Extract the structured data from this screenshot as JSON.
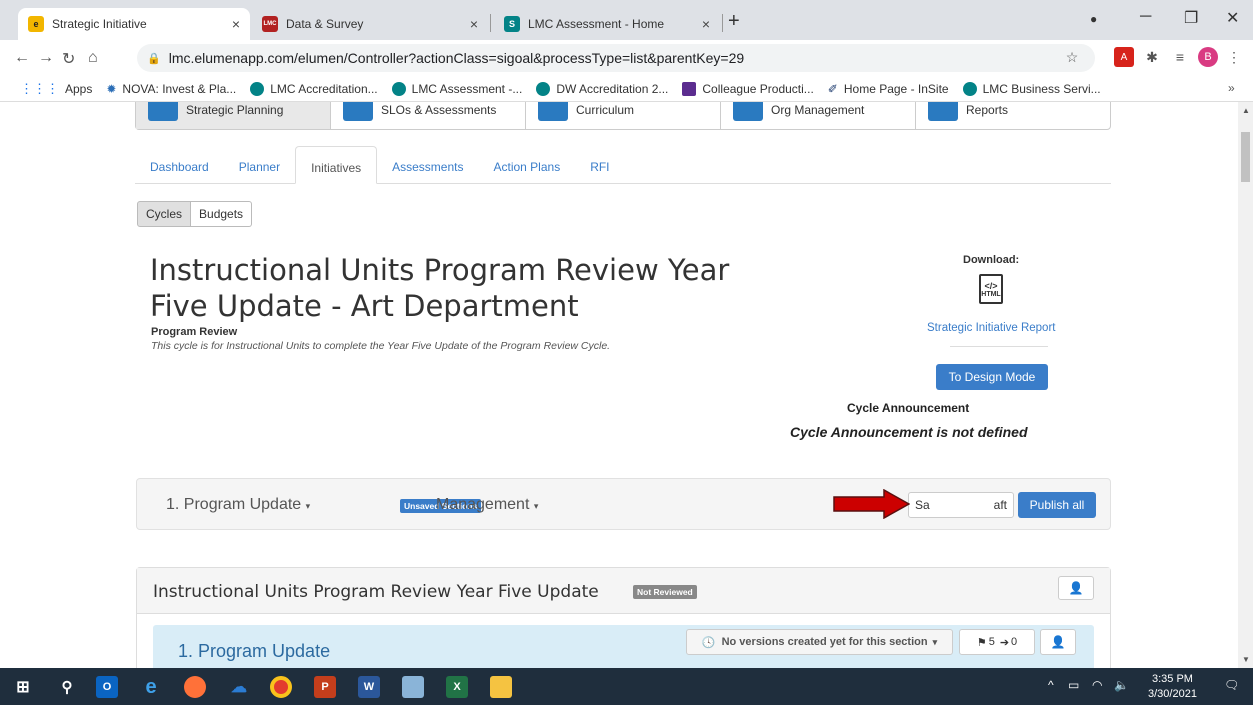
{
  "browser": {
    "tabs": [
      {
        "title": "Strategic Initiative",
        "favicon": "e",
        "favicon_color": "#f2b600",
        "active": true
      },
      {
        "title": "Data & Survey",
        "favicon": "LMC",
        "favicon_color": "#b22222",
        "active": false
      },
      {
        "title": "LMC Assessment - Home",
        "favicon": "S",
        "favicon_color": "#038387",
        "active": false
      }
    ],
    "close_glyph": "×",
    "new_tab_glyph": "+",
    "window_controls": {
      "minimize": "─",
      "restore": "❐",
      "close": "✕"
    },
    "url": "lmc.elumenapp.com/elumen/Controller?actionClass=sigoal&processType=list&parentKey=29",
    "profile_initial": "B",
    "bookmarks": [
      "Apps",
      "NOVA: Invest & Pla...",
      "LMC Accreditation...",
      "LMC Assessment -...",
      "DW Accreditation 2...",
      "Colleague Producti...",
      "Home Page - InSite",
      "LMC Business Servi..."
    ],
    "bookmarks_more": "»"
  },
  "app": {
    "modules": [
      "Strategic Planning",
      "SLOs & Assessments",
      "Curriculum",
      "Org Management",
      "Reports"
    ],
    "subtabs": [
      "Dashboard",
      "Planner",
      "Initiatives",
      "Assessments",
      "Action Plans",
      "RFI"
    ],
    "button_group": [
      "Cycles",
      "Budgets"
    ],
    "page_title": "Instructional Units Program Review Year Five Update - Art Department",
    "subheading": "Program Review",
    "description": "This cycle is for Instructional Units to complete the Year Five Update of the Program Review Cycle.",
    "download_label": "Download:",
    "html_icon_text": "HTML",
    "report_link": "Strategic Initiative Report",
    "design_button": "To Design Mode",
    "announcement_heading": "Cycle Announcement",
    "announcement_value": "Cycle Announcement is not defined",
    "actionbar": {
      "section": "1. Program Update",
      "unsaved_badge": "Unsaved Sections",
      "management": "Management",
      "save_draft": "Save Draft",
      "save_visible_left": "Sa",
      "save_visible_right": "aft",
      "publish_all": "Publish all"
    },
    "panel": {
      "title": "Instructional Units Program Review Year Five Update",
      "status_badge": "Not Reviewed",
      "section_title": "1. Program Update",
      "versions": "No versions created yet for this section",
      "flags_count": "5",
      "arrow_count": "0"
    }
  },
  "taskbar": {
    "time": "3:35 PM",
    "date": "3/30/2021"
  },
  "colors": {
    "accent": "#3a7dc9",
    "annotation_arrow": "#cc0000"
  }
}
